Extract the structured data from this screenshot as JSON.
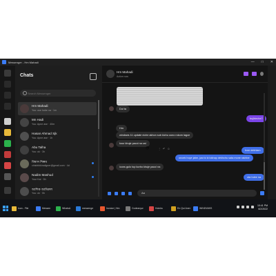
{
  "window": {
    "title": "Messenger - Hm Mahadi"
  },
  "sidebar": {
    "title": "Chats",
    "search_placeholder": "Search Messenger",
    "chats": [
      {
        "name": "Hm Mahadi",
        "preview": "You: use hobe na · 1m",
        "active": true,
        "unread": false
      },
      {
        "name": "Mn Hadi",
        "preview": "You: Apne ase · 40m",
        "active": false,
        "unread": false
      },
      {
        "name": "Hasan Ahmad Sjk",
        "preview": "You: Apne ase · 1h",
        "active": false,
        "unread": false
      },
      {
        "name": "Abu Talha",
        "preview": "You: ok · 3h",
        "active": false,
        "unread": false
      },
      {
        "name": "বিশ্বাস শিল্পম",
        "preview": "chishthikinaligner@gmail.com · 4d",
        "active": false,
        "unread": true
      },
      {
        "name": "Nadim Mashud",
        "preview": "Your Kai · 5h",
        "active": false,
        "unread": true
      },
      {
        "name": "আশিক আমিরুল",
        "preview": "You: ok · 5h",
        "active": false,
        "unread": false
      }
    ]
  },
  "conversation": {
    "name": "Hm Mahadi",
    "status": "Active now",
    "messages": [
      {
        "dir": "in",
        "text": "Dui ta"
      },
      {
        "dir": "out_purple",
        "text": "bujhteche?"
      },
      {
        "dir": "in",
        "text": "Hm"
      },
      {
        "dir": "in",
        "text": "windows 11 update niche akhon sob kichu oono rokom lagce"
      },
      {
        "dir": "in",
        "text": "kour khuje pacci na vai"
      },
      {
        "dir": "in_emoji",
        "text": "😔"
      },
      {
        "dir": "out",
        "text": "Icon dekhlam"
      },
      {
        "dir": "out",
        "text": "onoek hoye jabe, just ki ki lokhap dekhchu sata mone rakhbe"
      },
      {
        "dir": "in",
        "text": "icons gulo top korbo khuje pacci na"
      },
      {
        "dir": "out",
        "text": "ota hobe na"
      }
    ],
    "input_text": "Aa"
  },
  "taskbar": {
    "items": [
      {
        "label": "Icon - File",
        "color": "#e8b93a"
      },
      {
        "label": "Messen",
        "color": "#3b7cf5"
      },
      {
        "label": "WhatsA",
        "color": "#2bb24c"
      },
      {
        "label": "messenge",
        "color": "#2a7ad8"
      },
      {
        "label": "Invoice | Hm",
        "color": "#e8572f"
      },
      {
        "label": "Codeanyw",
        "color": "#7a7a7a"
      },
      {
        "label": "Hoinks",
        "color": "#d64545"
      },
      {
        "label": "En Qui Aner",
        "color": "#d0a020"
      },
      {
        "label": "WINDWWS",
        "color": "#3b7cf5"
      }
    ],
    "time": "10:41 PM",
    "date": "6/2/2022"
  }
}
